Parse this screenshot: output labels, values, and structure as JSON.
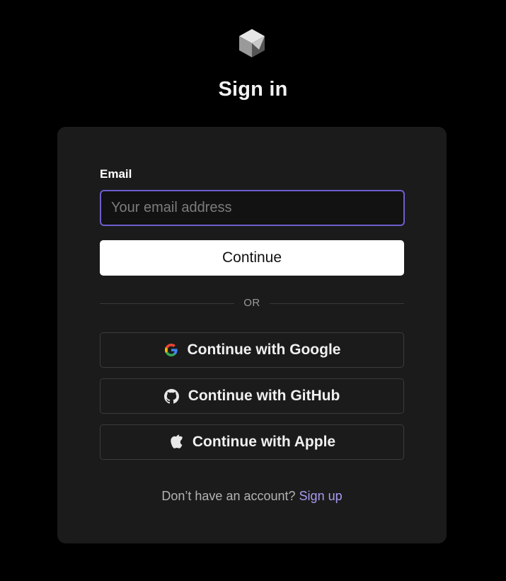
{
  "header": {
    "logo_icon": "cube-logo-icon",
    "title": "Sign in"
  },
  "form": {
    "email_label": "Email",
    "email_placeholder": "Your email address",
    "email_value": "",
    "continue_label": "Continue",
    "divider_text": "OR"
  },
  "oauth": {
    "google_label": "Continue with Google",
    "google_icon": "google-icon",
    "github_label": "Continue with GitHub",
    "github_icon": "github-icon",
    "apple_label": "Continue with Apple",
    "apple_icon": "apple-icon"
  },
  "footer": {
    "prompt": "Don’t have an account?",
    "signup_label": "Sign up"
  },
  "colors": {
    "background": "#000000",
    "card": "#1b1b1b",
    "input_focus_border": "#6b5fcf",
    "link": "#a79bf0"
  }
}
